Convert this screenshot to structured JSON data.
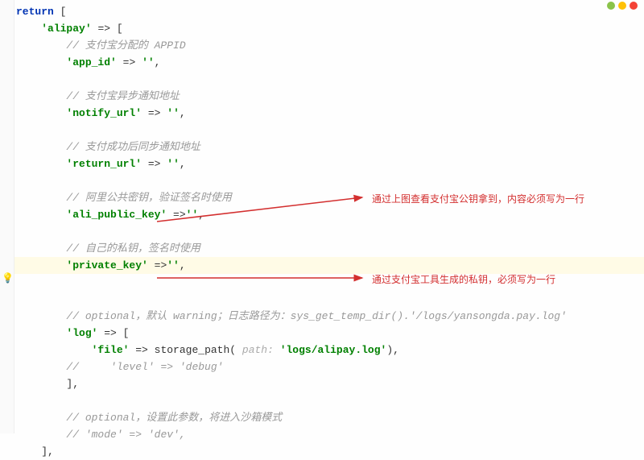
{
  "window": {
    "dots": [
      "green",
      "gold",
      "red"
    ]
  },
  "code": {
    "l1_kw": "return",
    "l1_rest": " [",
    "l2_key": "'alipay'",
    "l2_rest": " => [",
    "c1": "// 支付宝分配的 APPID",
    "k_appid": "'app_id'",
    "v_empty": "''",
    "c2": "// 支付宝异步通知地址",
    "k_notify": "'notify_url'",
    "c3": "// 支付成功后同步通知地址",
    "k_return": "'return_url'",
    "c4": "// 阿里公共密钥，验证签名时使用",
    "k_pubkey": "'ali_public_key'",
    "c5": "// 自己的私钥，签名时使用",
    "k_privkey": "'private_key'",
    "c6a": "// optional，默认 warning；日志路径为：sys_get_temp_dir().'/logs/",
    "c6b": "yansongda",
    "c6c": ".pay.log'",
    "k_log": "'log'",
    "k_file": "'file'",
    "fn_storage": "storage_path",
    "hint_path": " path: ",
    "v_logpath": "'logs/alipay.log'",
    "c7": "//     'level' => 'debug'",
    "close_arr": "],",
    "c8": "// optional，设置此参数，将进入沙箱模式",
    "c9": "// 'mode' => 'dev',",
    "close2": "],"
  },
  "annotations": {
    "a1": "通过上图查看支付宝公钥拿到，内容必须写为一行",
    "a2": "通过支付宝工具生成的私钥，必须写为一行"
  }
}
